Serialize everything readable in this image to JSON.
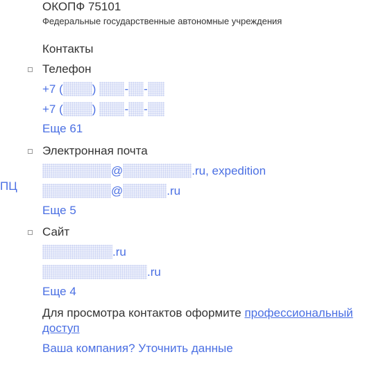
{
  "okopf": {
    "code": "ОКОПФ 75101",
    "description": "Федеральные государственные автономные учреждения"
  },
  "contacts": {
    "title": "Контакты",
    "side_fragment": "ПЦ",
    "phone": {
      "label": "Телефон",
      "prefix": "+7 (",
      "close_paren": ")",
      "dash": "-",
      "more": "Еще 61"
    },
    "email": {
      "label": "Электронная почта",
      "at": "@",
      "suffix_1": ".ru, expedition",
      "suffix_2": ".ru",
      "more": "Еще 5"
    },
    "site": {
      "label": "Сайт",
      "suffix": ".ru",
      "more": "Еще 4"
    }
  },
  "cta": {
    "text": "Для просмотра контактов оформите ",
    "link": "профессиональный доступ"
  },
  "company_link": "Ваша компания? Уточнить данные"
}
